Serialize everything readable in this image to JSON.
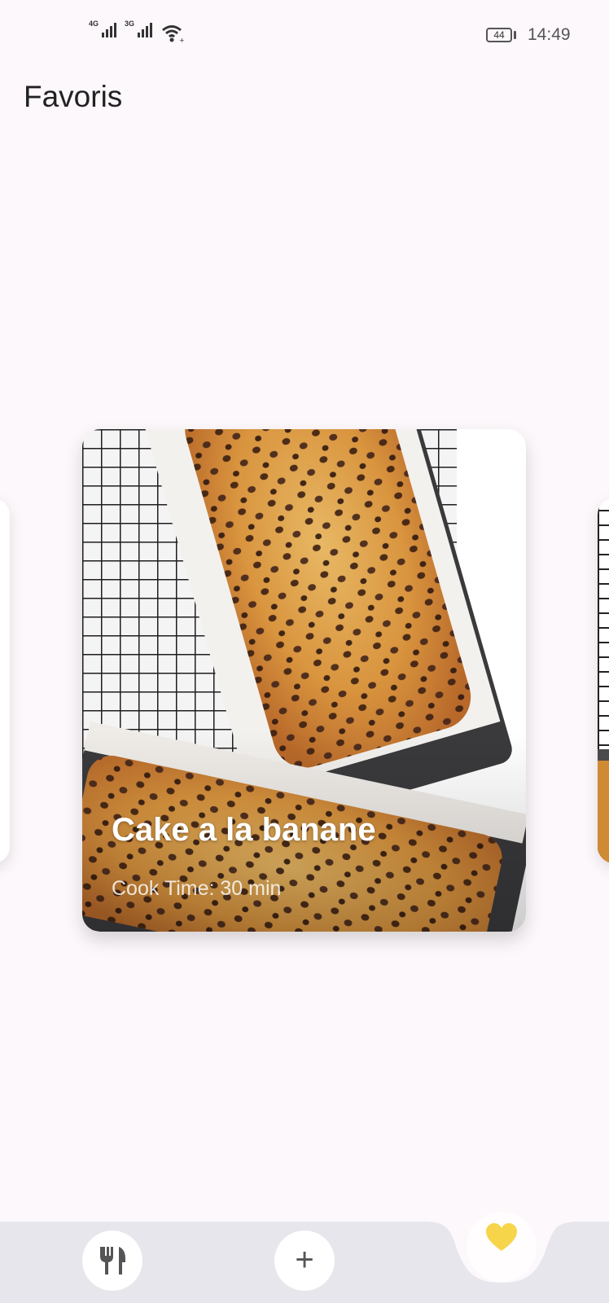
{
  "status_bar": {
    "signal1_label": "4G",
    "signal2_label": "3G",
    "battery": "44",
    "time": "14:49"
  },
  "page": {
    "title": "Favoris"
  },
  "carousel": {
    "current": {
      "name": "Cake a la banane",
      "cook_time": "Cook Time: 30 min"
    }
  },
  "bottom_nav": {
    "items": [
      {
        "icon": "fork-knife-icon"
      },
      {
        "icon": "plus-icon"
      },
      {
        "icon": "heart-icon",
        "active": true
      }
    ],
    "active_color": "#f7d54a",
    "bar_color": "#e6e6ec"
  }
}
